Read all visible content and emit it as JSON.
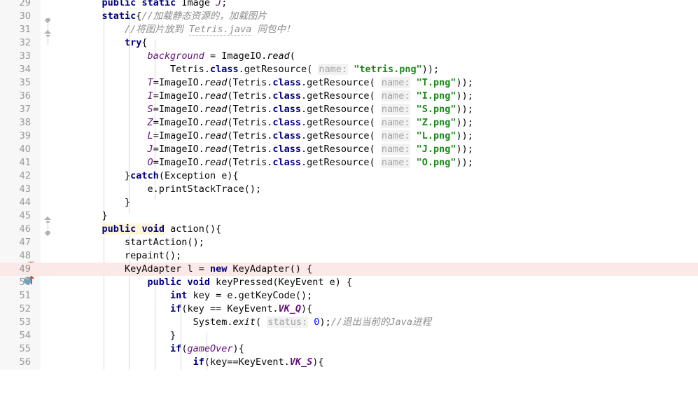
{
  "editor": {
    "app": "intellij-idea-code-editor",
    "language": "Java",
    "first_line_number": 29,
    "line_height_px": 19,
    "colors": {
      "background": "#ffffff",
      "gutter": "#f7f7f7",
      "line_number": "#999999",
      "keyword": "#000080",
      "string": "#1a8a1a",
      "number": "#0000ff",
      "field": "#660e7a",
      "comment": "#8c8c8c",
      "param_hint": "#a3a3a3",
      "breakpoint_line": "#fbe9e7",
      "breakpoint_marker": "#e05c4f",
      "identifier_highlight": "#fdf6d8"
    },
    "gutter_icons": {
      "breakpoint_line": 49,
      "override_icon_line": 50,
      "fold_lines": [
        30,
        31,
        45,
        46,
        49
      ]
    },
    "lines": [
      {
        "n": 29,
        "text": "    public static Image J;"
      },
      {
        "n": 30,
        "text": "    static{//加载静态资源的，加载图片"
      },
      {
        "n": 31,
        "text": "        //将图片放到 Tetris.java 同包中！"
      },
      {
        "n": 32,
        "text": "        try{"
      },
      {
        "n": 33,
        "text": "            background = ImageIO.read("
      },
      {
        "n": 34,
        "text": "                Tetris.class.getResource( name: \"tetris.png\"));"
      },
      {
        "n": 35,
        "text": "            T=ImageIO.read(Tetris.class.getResource( name: \"T.png\"));"
      },
      {
        "n": 36,
        "text": "            I=ImageIO.read(Tetris.class.getResource( name: \"I.png\"));"
      },
      {
        "n": 37,
        "text": "            S=ImageIO.read(Tetris.class.getResource( name: \"S.png\"));"
      },
      {
        "n": 38,
        "text": "            Z=ImageIO.read(Tetris.class.getResource( name: \"Z.png\"));"
      },
      {
        "n": 39,
        "text": "            L=ImageIO.read(Tetris.class.getResource( name: \"L.png\"));"
      },
      {
        "n": 40,
        "text": "            J=ImageIO.read(Tetris.class.getResource( name: \"J.png\"));"
      },
      {
        "n": 41,
        "text": "            O=ImageIO.read(Tetris.class.getResource( name: \"O.png\"));"
      },
      {
        "n": 42,
        "text": "        }catch(Exception e){"
      },
      {
        "n": 43,
        "text": "            e.printStackTrace();"
      },
      {
        "n": 44,
        "text": "        }"
      },
      {
        "n": 45,
        "text": "    }"
      },
      {
        "n": 46,
        "text": "    public void action(){"
      },
      {
        "n": 47,
        "text": "        startAction();"
      },
      {
        "n": 48,
        "text": "        repaint();"
      },
      {
        "n": 49,
        "text": "        KeyAdapter l = new KeyAdapter() {"
      },
      {
        "n": 50,
        "text": "            public void keyPressed(KeyEvent e) {"
      },
      {
        "n": 51,
        "text": "                int key = e.getKeyCode();"
      },
      {
        "n": 52,
        "text": "                if(key == KeyEvent.VK_Q){"
      },
      {
        "n": 53,
        "text": "                    System.exit( status: 0);//退出当前的Java进程"
      },
      {
        "n": 54,
        "text": "                }"
      },
      {
        "n": 55,
        "text": "                if(gameOver){"
      },
      {
        "n": 56,
        "text": "                    if(key==KeyEvent.VK_S){"
      }
    ],
    "tokens": {
      "l29": {
        "kw1": "public",
        "kw2": "static",
        "type": "Image",
        "field": "J",
        "semi": ";"
      },
      "l30": {
        "kw": "static",
        "brace": "{",
        "comment": "//加载静态资源的，加载图片"
      },
      "l31": {
        "comment_a": "//将图片放到 ",
        "comment_ref": "Tetris.java",
        "comment_b": " 同包中！"
      },
      "l32": {
        "kw": "try",
        "brace": "{"
      },
      "l33": {
        "field": "background",
        "eq": " = ",
        "cls": "ImageIO.",
        "mth": "read",
        "paren": "("
      },
      "l34": {
        "cls": "Tetris.",
        "kw": "class",
        "mth": ".getResource(",
        "hint": "name:",
        "str": "\"tetris.png\"",
        "tail": "));"
      },
      "l35": {
        "field": "T",
        "str": "\"T.png\""
      },
      "l36": {
        "field": "I",
        "str": "\"I.png\""
      },
      "l37": {
        "field": "S",
        "str": "\"S.png\""
      },
      "l38": {
        "field": "Z",
        "str": "\"Z.png\""
      },
      "l39": {
        "field": "L",
        "str": "\"L.png\""
      },
      "l40": {
        "field": "J",
        "str": "\"J.png\""
      },
      "l41": {
        "field": "O",
        "str": "\"O.png\""
      },
      "common": {
        "assign_prefix": "=ImageIO.",
        "read": "read",
        "open": "(Tetris.",
        "class_kw": "class",
        "getresource": ".getResource(",
        "hint_name": "name:",
        "tail": "));"
      },
      "l42": {
        "brace": "}",
        "kw": "catch",
        "rest": "(Exception e){"
      },
      "l43": {
        "text": "e.printStackTrace();"
      },
      "l44": {
        "text": "}"
      },
      "l45": {
        "text": "}"
      },
      "l46": {
        "kw1": "public",
        "kw2": "void",
        "name": " action(){"
      },
      "l47": {
        "text": "startAction();"
      },
      "l48": {
        "text": "repaint();"
      },
      "l49": {
        "type": "KeyAdapter",
        "var": " l = ",
        "kw": "new",
        "rest": " KeyAdapter() {"
      },
      "l50": {
        "kw1": "public",
        "kw2": "void",
        "rest": " keyPressed(KeyEvent e) {"
      },
      "l51": {
        "kw": "int",
        "rest": " key = e.getKeyCode();"
      },
      "l52": {
        "kw": "if",
        "a": "(key == KeyEvent.",
        "const": "VK_Q",
        "b": "){"
      },
      "l53": {
        "a": "System.",
        "mth": "exit",
        "b": "( ",
        "hint": "status:",
        "num": "0",
        "c": ");",
        "comment": "//退出当前的Java进程"
      },
      "l54": {
        "text": "}"
      },
      "l55": {
        "kw": "if",
        "a": "(",
        "field": "gameOver",
        "b": "){"
      },
      "l56": {
        "kw": "if",
        "a": "(key==KeyEvent.",
        "const": "VK_S",
        "b": "){"
      }
    }
  }
}
